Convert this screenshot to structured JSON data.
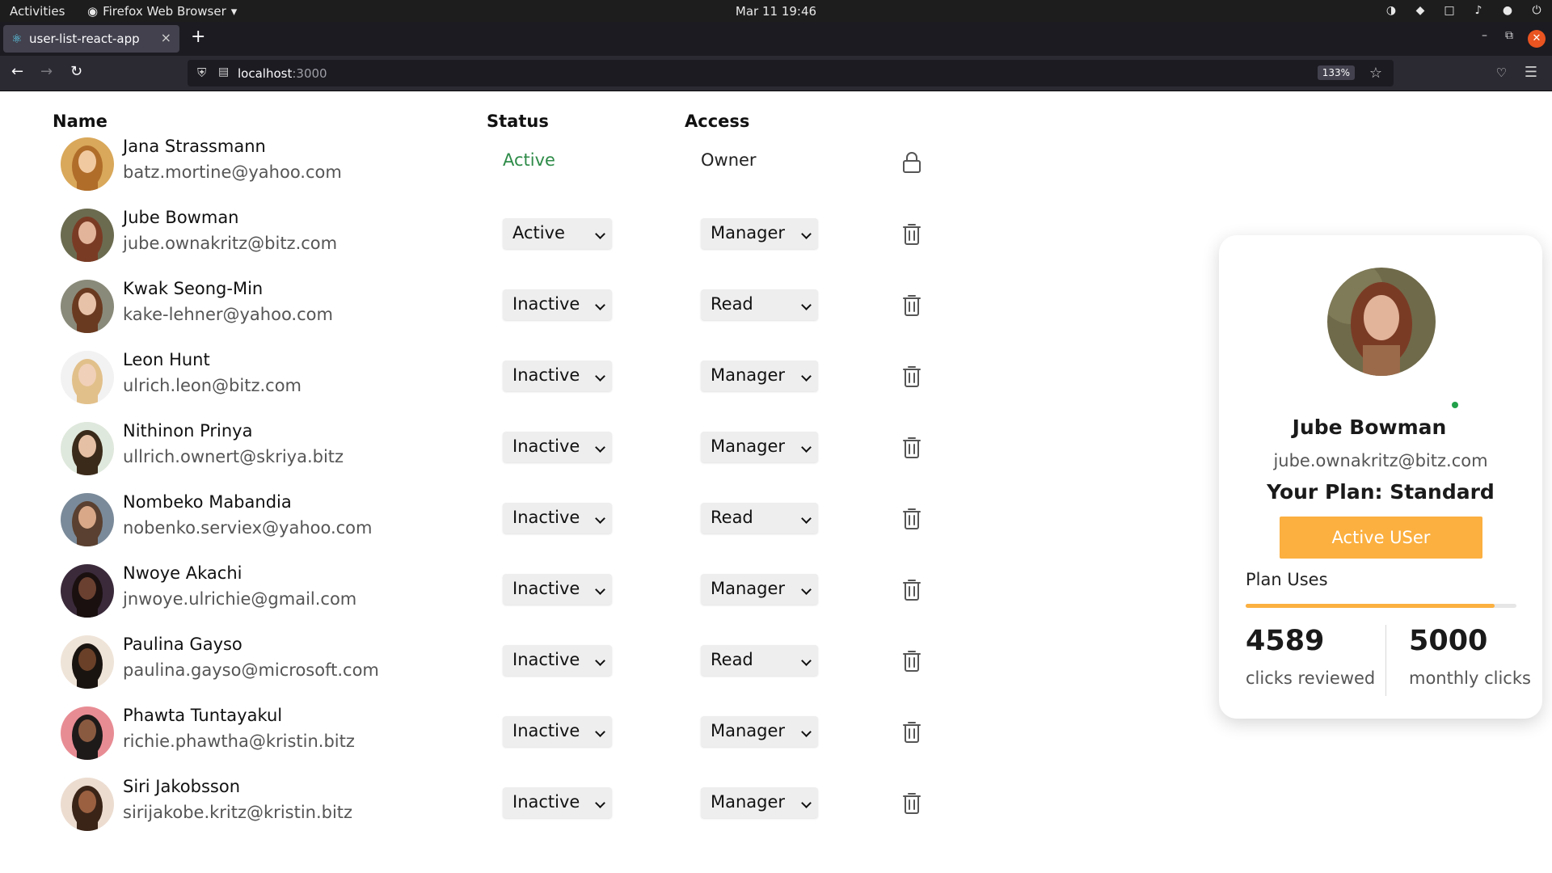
{
  "system_bar": {
    "activities": "Activities",
    "app_name": "Firefox Web Browser",
    "datetime": "Mar 11  19:46"
  },
  "browser": {
    "tab_title": "user-list-react-app",
    "url_host": "localhost",
    "url_port": ":3000",
    "zoom": "133%"
  },
  "table": {
    "headers": {
      "name": "Name",
      "status": "Status",
      "access": "Access"
    },
    "users": [
      {
        "name": "Jana Strassmann",
        "email": "batz.mortine@yahoo.com",
        "status": "Active",
        "access": "Owner",
        "editable": false
      },
      {
        "name": "Jube Bowman",
        "email": "jube.ownakritz@bitz.com",
        "status": "Active",
        "access": "Manager",
        "editable": true
      },
      {
        "name": "Kwak Seong-Min",
        "email": "kake-lehner@yahoo.com",
        "status": "Inactive",
        "access": "Read",
        "editable": true
      },
      {
        "name": "Leon Hunt",
        "email": "ulrich.leon@bitz.com",
        "status": "Inactive",
        "access": "Manager",
        "editable": true
      },
      {
        "name": "Nithinon Prinya",
        "email": "ullrich.ownert@skriya.bitz",
        "status": "Inactive",
        "access": "Manager",
        "editable": true
      },
      {
        "name": "Nombeko Mabandia",
        "email": "nobenko.serviex@yahoo.com",
        "status": "Inactive",
        "access": "Read",
        "editable": true
      },
      {
        "name": "Nwoye Akachi",
        "email": "jnwoye.ulrichie@gmail.com",
        "status": "Inactive",
        "access": "Manager",
        "editable": true
      },
      {
        "name": "Paulina Gayso",
        "email": "paulina.gayso@microsoft.com",
        "status": "Inactive",
        "access": "Read",
        "editable": true
      },
      {
        "name": "Phawta Tuntayakul",
        "email": "richie.phawtha@kristin.bitz",
        "status": "Inactive",
        "access": "Manager",
        "editable": true
      },
      {
        "name": "Siri Jakobsson",
        "email": "sirijakobe.kritz@kristin.bitz",
        "status": "Inactive",
        "access": "Manager",
        "editable": true
      }
    ]
  },
  "card": {
    "name": "Jube Bowman",
    "email": "jube.ownakritz@bitz.com",
    "plan": "Your Plan: Standard",
    "button": "Active USer",
    "uses_label": "Plan Uses",
    "usage_fraction": 0.92,
    "clicks_reviewed": "4589",
    "clicks_reviewed_label": "clicks reviewed",
    "monthly_clicks": "5000",
    "monthly_clicks_label": "monthly clicks"
  },
  "colors": {
    "accent": "#fbb040",
    "active_status": "#2e8b48",
    "online_dot": "#22a04a"
  }
}
